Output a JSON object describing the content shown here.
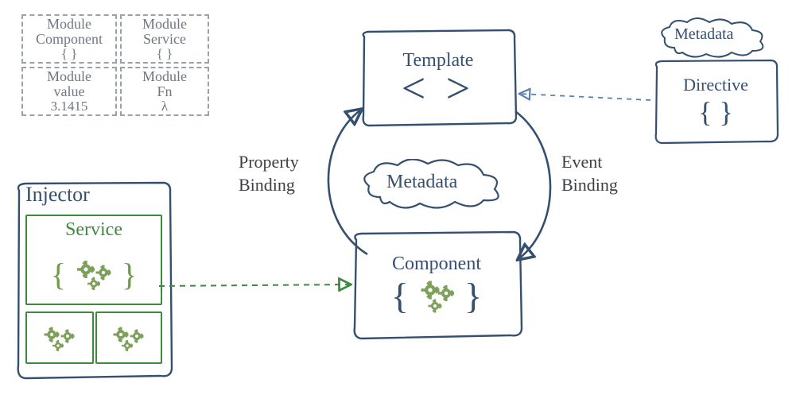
{
  "modules": {
    "component": {
      "label": "Module",
      "sub": "Component",
      "symbol": "{ }"
    },
    "service": {
      "label": "Module",
      "sub": "Service",
      "symbol": "{ }"
    },
    "value": {
      "label": "Module",
      "sub": "value",
      "symbol": "3.1415"
    },
    "fn": {
      "label": "Module",
      "sub": "Fn",
      "symbol": "λ"
    }
  },
  "template": {
    "title": "Template",
    "symbol": "< >"
  },
  "component": {
    "title": "Component",
    "symbol": "{ }"
  },
  "directive": {
    "title": "Directive",
    "symbol": "{ }"
  },
  "injector": {
    "title": "Injector",
    "service_title": "Service",
    "service_symbol": "{ }"
  },
  "labels": {
    "property_binding": "Property\nBinding",
    "event_binding": "Event\nBinding",
    "metadata_center": "Metadata",
    "metadata_dir": "Metadata"
  },
  "chart_data": {
    "type": "diagram",
    "title": "Angular architecture overview",
    "nodes": [
      {
        "id": "module-component",
        "label": "Module Component { }",
        "group": "modules"
      },
      {
        "id": "module-service",
        "label": "Module Service { }",
        "group": "modules"
      },
      {
        "id": "module-value",
        "label": "Module value 3.1415",
        "group": "modules"
      },
      {
        "id": "module-fn",
        "label": "Module Fn λ",
        "group": "modules"
      },
      {
        "id": "injector",
        "label": "Injector"
      },
      {
        "id": "service",
        "label": "Service { gears }",
        "parent": "injector"
      },
      {
        "id": "template",
        "label": "Template < >"
      },
      {
        "id": "component",
        "label": "Component { gears }"
      },
      {
        "id": "directive",
        "label": "Directive { }"
      },
      {
        "id": "metadata-center",
        "label": "Metadata",
        "kind": "annotation"
      },
      {
        "id": "metadata-dir",
        "label": "Metadata",
        "kind": "annotation"
      }
    ],
    "edges": [
      {
        "from": "component",
        "to": "template",
        "label": "Property Binding",
        "style": "solid-curve"
      },
      {
        "from": "template",
        "to": "component",
        "label": "Event Binding",
        "style": "solid-curve"
      },
      {
        "from": "service",
        "to": "component",
        "style": "dashed",
        "color": "green"
      },
      {
        "from": "directive",
        "to": "template",
        "style": "dashed",
        "color": "blue"
      },
      {
        "from": "metadata-center",
        "to": "template",
        "style": "attach"
      },
      {
        "from": "metadata-center",
        "to": "component",
        "style": "attach"
      },
      {
        "from": "metadata-dir",
        "to": "directive",
        "style": "attach"
      }
    ]
  }
}
